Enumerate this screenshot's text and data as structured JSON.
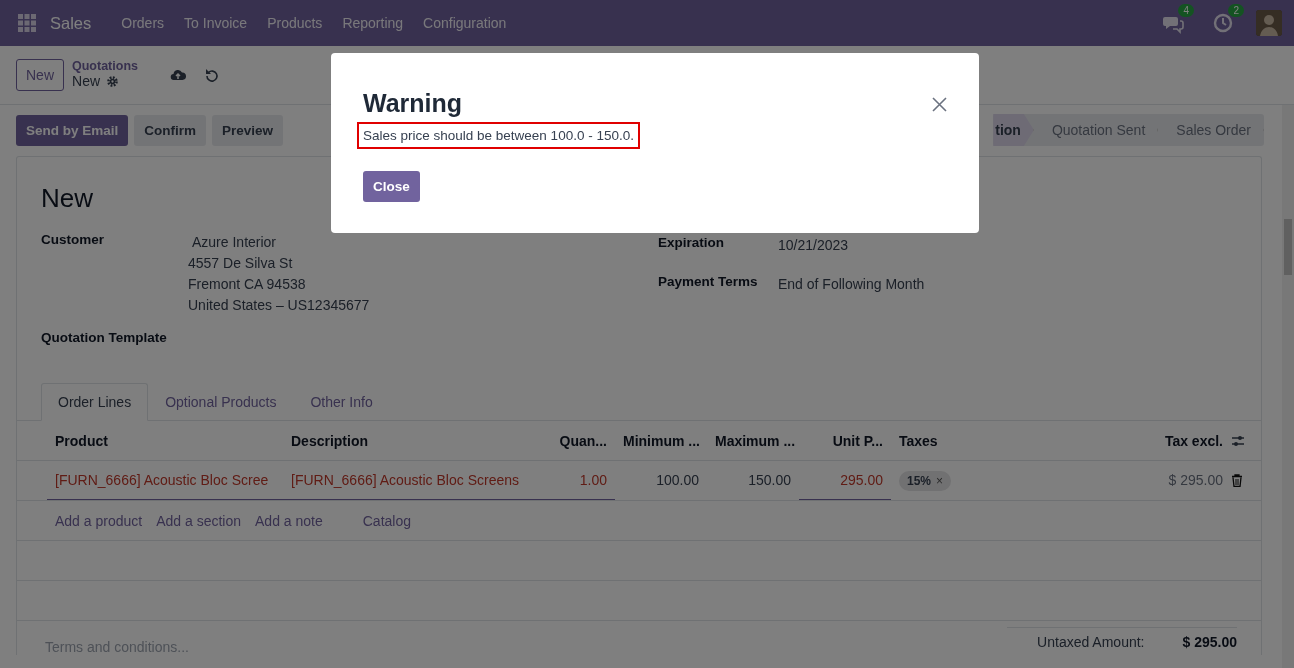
{
  "navbar": {
    "app": "Sales",
    "menu": [
      "Orders",
      "To Invoice",
      "Products",
      "Reporting",
      "Configuration"
    ],
    "badges": [
      {
        "kind": "chat",
        "count": "4"
      },
      {
        "kind": "activity",
        "count": "2"
      }
    ]
  },
  "control_panel": {
    "new_button": "New",
    "breadcrumb": "Quotations",
    "record": "New"
  },
  "actions": [
    {
      "label": "Send by Email",
      "primary": true
    },
    {
      "label": "Confirm",
      "primary": false
    },
    {
      "label": "Preview",
      "primary": false
    }
  ],
  "stages": [
    {
      "label": "tion",
      "selected": true
    },
    {
      "label": "Quotation Sent",
      "selected": false
    },
    {
      "label": "Sales Order",
      "selected": false
    }
  ],
  "form": {
    "title": "New",
    "customer_label": "Customer",
    "customer_name": "Azure Interior",
    "address": [
      "4557 De Silva St",
      "Fremont CA 94538",
      "United States – US12345677"
    ],
    "template_label": "Quotation Template",
    "right_fields": [
      {
        "label": "Expiration",
        "value": "10/21/2023"
      },
      {
        "label": "Payment Terms",
        "value": "End of Following Month"
      }
    ]
  },
  "tabs": [
    {
      "label": "Order Lines",
      "selected": true
    },
    {
      "label": "Optional Products",
      "selected": false
    },
    {
      "label": "Other Info",
      "selected": false
    }
  ],
  "table": {
    "columns": [
      "Product",
      "Description",
      "Quan...",
      "Minimum ...",
      "Maximum ...",
      "Unit P...",
      "Taxes",
      "Tax excl."
    ],
    "rows": [
      {
        "cells": [
          {
            "text": "[FURN_6666] Acoustic Bloc Scree",
            "invalid": true,
            "editable": true
          },
          {
            "text": "[FURN_6666] Acoustic Bloc Screens",
            "invalid": true,
            "editable": true
          },
          {
            "text": "1.00",
            "invalid": true,
            "editable": true
          },
          {
            "text": "100.00",
            "invalid": false,
            "editable": false
          },
          {
            "text": "150.00",
            "invalid": false,
            "editable": false
          },
          {
            "text": "295.00",
            "invalid": true,
            "editable": true
          }
        ],
        "tax": "15%",
        "tax_remove": "×",
        "total": "$ 295.00"
      }
    ],
    "add_links": [
      "Add a product",
      "Add a section",
      "Add a note",
      "Catalog"
    ]
  },
  "terms_placeholder": "Terms and conditions...",
  "totals": [
    {
      "label": "Untaxed Amount:",
      "value": "$ 295.00"
    }
  ],
  "dialog": {
    "title": "Warning",
    "message": "Sales price should be between 100.0 - 150.0.",
    "highlighted": true,
    "button": "Close"
  }
}
